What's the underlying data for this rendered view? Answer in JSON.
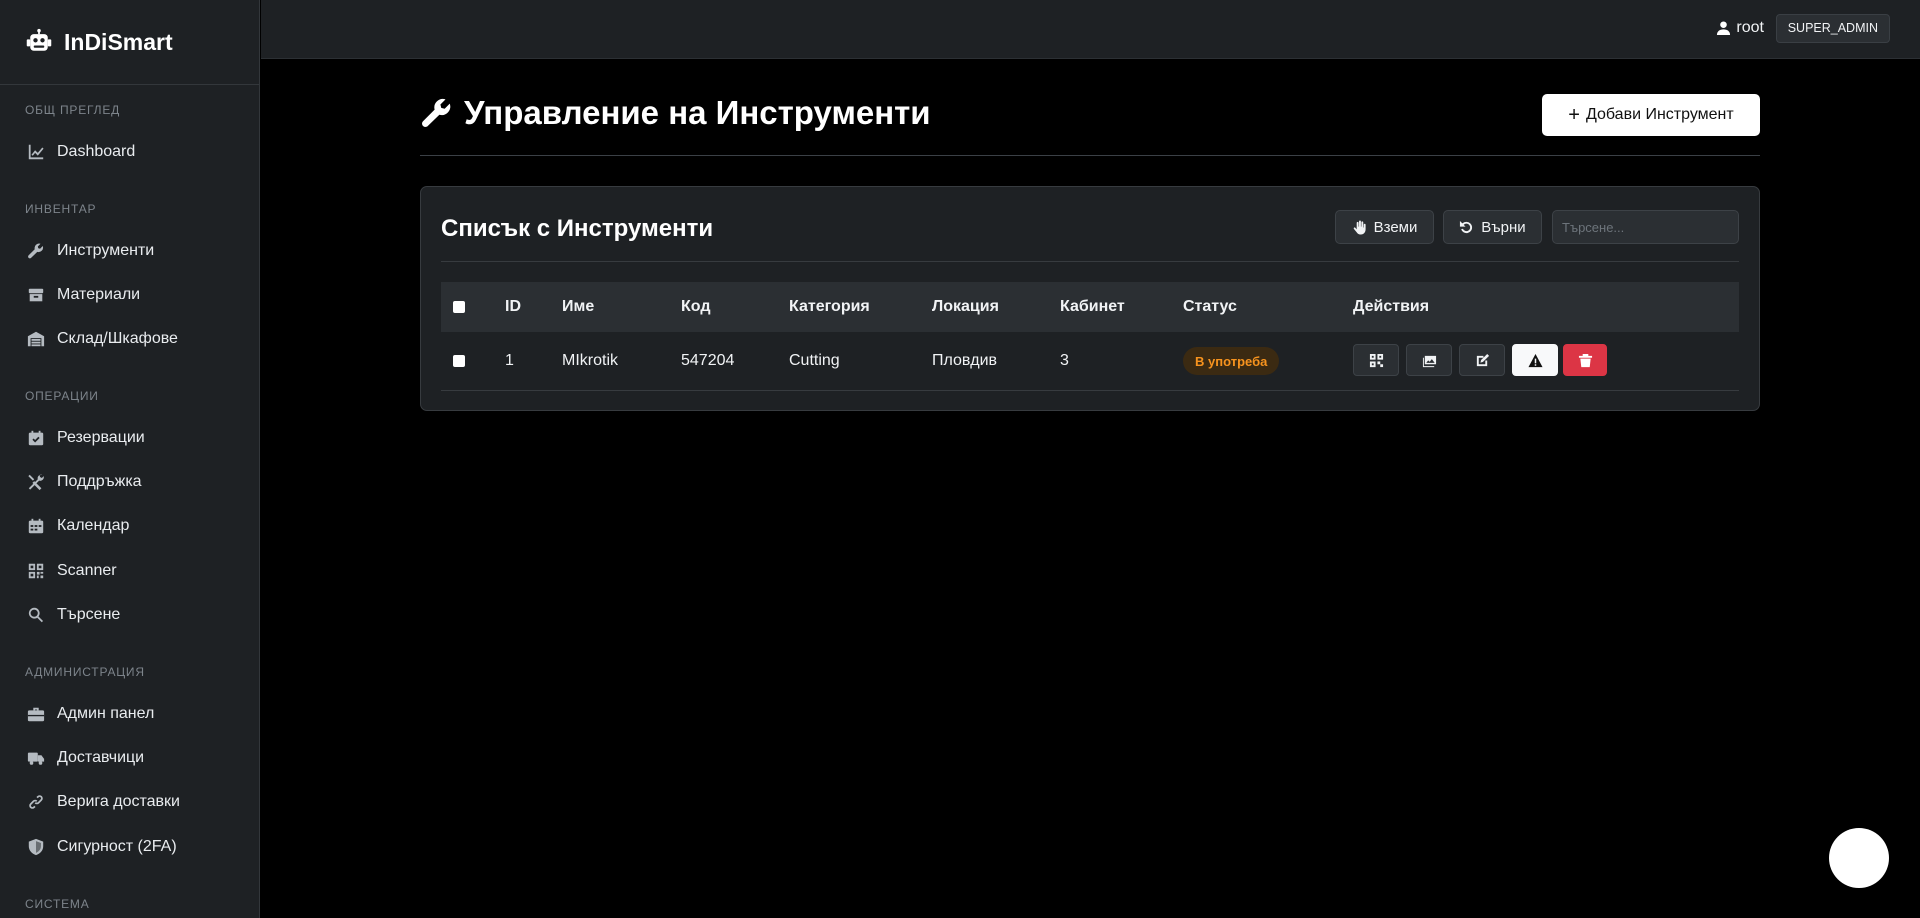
{
  "brand": {
    "name": "InDiSmart"
  },
  "sidebar": {
    "sections": [
      {
        "title": "Общ преглед",
        "items": [
          {
            "label": "Dashboard",
            "icon": "chart-line-icon"
          }
        ]
      },
      {
        "title": "Инвентар",
        "items": [
          {
            "label": "Инструменти",
            "icon": "wrench-icon"
          },
          {
            "label": "Материали",
            "icon": "box-icon"
          },
          {
            "label": "Склад/Шкафове",
            "icon": "warehouse-icon"
          }
        ]
      },
      {
        "title": "Операции",
        "items": [
          {
            "label": "Резервации",
            "icon": "calendar-check-icon"
          },
          {
            "label": "Поддръжка",
            "icon": "tools-icon"
          },
          {
            "label": "Календар",
            "icon": "calendar-icon"
          },
          {
            "label": "Scanner",
            "icon": "qrcode-icon"
          },
          {
            "label": "Търсене",
            "icon": "search-icon"
          }
        ]
      },
      {
        "title": "Администрация",
        "items": [
          {
            "label": "Админ панел",
            "icon": "toolbox-icon"
          },
          {
            "label": "Доставчици",
            "icon": "truck-icon"
          },
          {
            "label": "Верига доставки",
            "icon": "link-icon"
          },
          {
            "label": "Сигурност (2FA)",
            "icon": "shield-icon"
          }
        ]
      },
      {
        "title": "Система",
        "items": []
      }
    ]
  },
  "topbar": {
    "user": "root",
    "role": "SUPER_ADMIN"
  },
  "page": {
    "title": "Управление на Инструменти",
    "add_button": "Добави Инструмент"
  },
  "card": {
    "title": "Списък с Инструменти",
    "take_button": "Вземи",
    "return_button": "Върни",
    "search_placeholder": "Търсене..."
  },
  "table": {
    "headers": {
      "id": "ID",
      "name": "Име",
      "code": "Код",
      "category": "Категория",
      "location": "Локация",
      "cabinet": "Кабинет",
      "status": "Статус",
      "actions": "Действия"
    },
    "rows": [
      {
        "id": "1",
        "name": "MIkrotik",
        "code": "547204",
        "category": "Cutting",
        "location": "Пловдив",
        "cabinet": "3",
        "status": "В употреба"
      }
    ]
  },
  "colors": {
    "background": "#000000",
    "panel": "#1e2124",
    "status_in_use_text": "#f7931e",
    "danger": "#dc3545"
  }
}
